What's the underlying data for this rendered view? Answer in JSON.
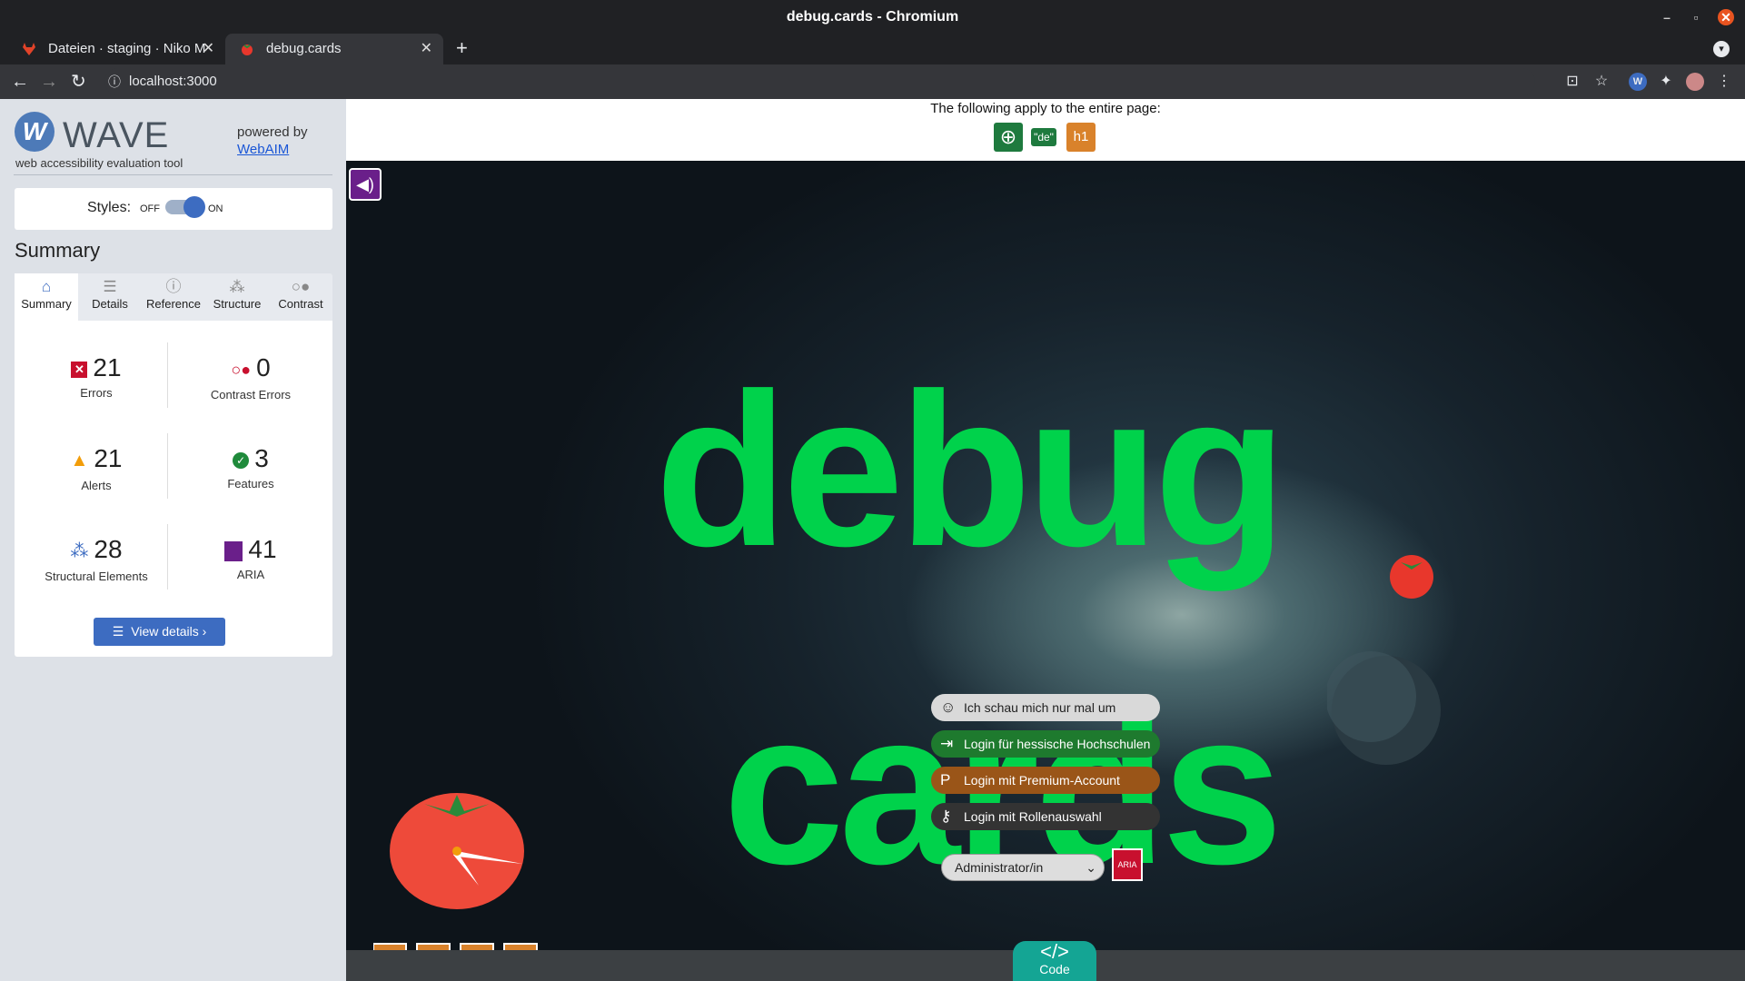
{
  "window": {
    "title": "debug.cards - Chromium"
  },
  "tabs": [
    {
      "label": "Dateien · staging · Niko M"
    },
    {
      "label": "debug.cards"
    }
  ],
  "address": {
    "url": "localhost:3000"
  },
  "wave": {
    "logo_letter": "W",
    "title": "WAVE",
    "subtitle": "web accessibility evaluation tool",
    "powered_by": "powered by",
    "webaim_link": "WebAIM",
    "styles_label": "Styles:",
    "styles_off": "OFF",
    "styles_on": "ON",
    "summary_heading": "Summary",
    "tabs": [
      {
        "label": "Summary",
        "icon": "home-icon"
      },
      {
        "label": "Details",
        "icon": "list-icon"
      },
      {
        "label": "Reference",
        "icon": "info-icon"
      },
      {
        "label": "Structure",
        "icon": "structure-icon"
      },
      {
        "label": "Contrast",
        "icon": "contrast-icon"
      }
    ],
    "stats": [
      {
        "value": "21",
        "label": "Errors",
        "color": "#c8102e"
      },
      {
        "value": "0",
        "label": "Contrast Errors",
        "color": "#c8102e"
      },
      {
        "value": "21",
        "label": "Alerts",
        "color": "#f29d0a"
      },
      {
        "value": "3",
        "label": "Features",
        "color": "#1f8a3b"
      },
      {
        "value": "28",
        "label": "Structural Elements",
        "color": "#3d6cc1"
      },
      {
        "value": "41",
        "label": "ARIA",
        "color": "#6a1f8a"
      }
    ],
    "view_details": "View details ›"
  },
  "page": {
    "entire_page_note": "The following apply to the entire page:",
    "lang_badge": "\"de\"",
    "h1_badge": "h1",
    "hero_word1": "debug",
    "hero_word2": "cards",
    "buttons": [
      {
        "label": "Ich schau mich nur mal um",
        "color": "#d9d9d9",
        "text_color": "#222"
      },
      {
        "label": "Login für hessische Hochschulen",
        "color": "#1e7a2e",
        "text_color": "#fff"
      },
      {
        "label": "Login mit Premium-Account",
        "color": "#9a5518",
        "text_color": "#fff"
      },
      {
        "label": "Login mit Rollenauswahl",
        "color": "#333333",
        "text_color": "#fff"
      }
    ],
    "role_select": "Administrator/in",
    "aria_badge": "ARIA",
    "code_button": "Code"
  },
  "colors": {
    "hero_green": "#00d24b",
    "wave_blue": "#3d6cc1"
  }
}
